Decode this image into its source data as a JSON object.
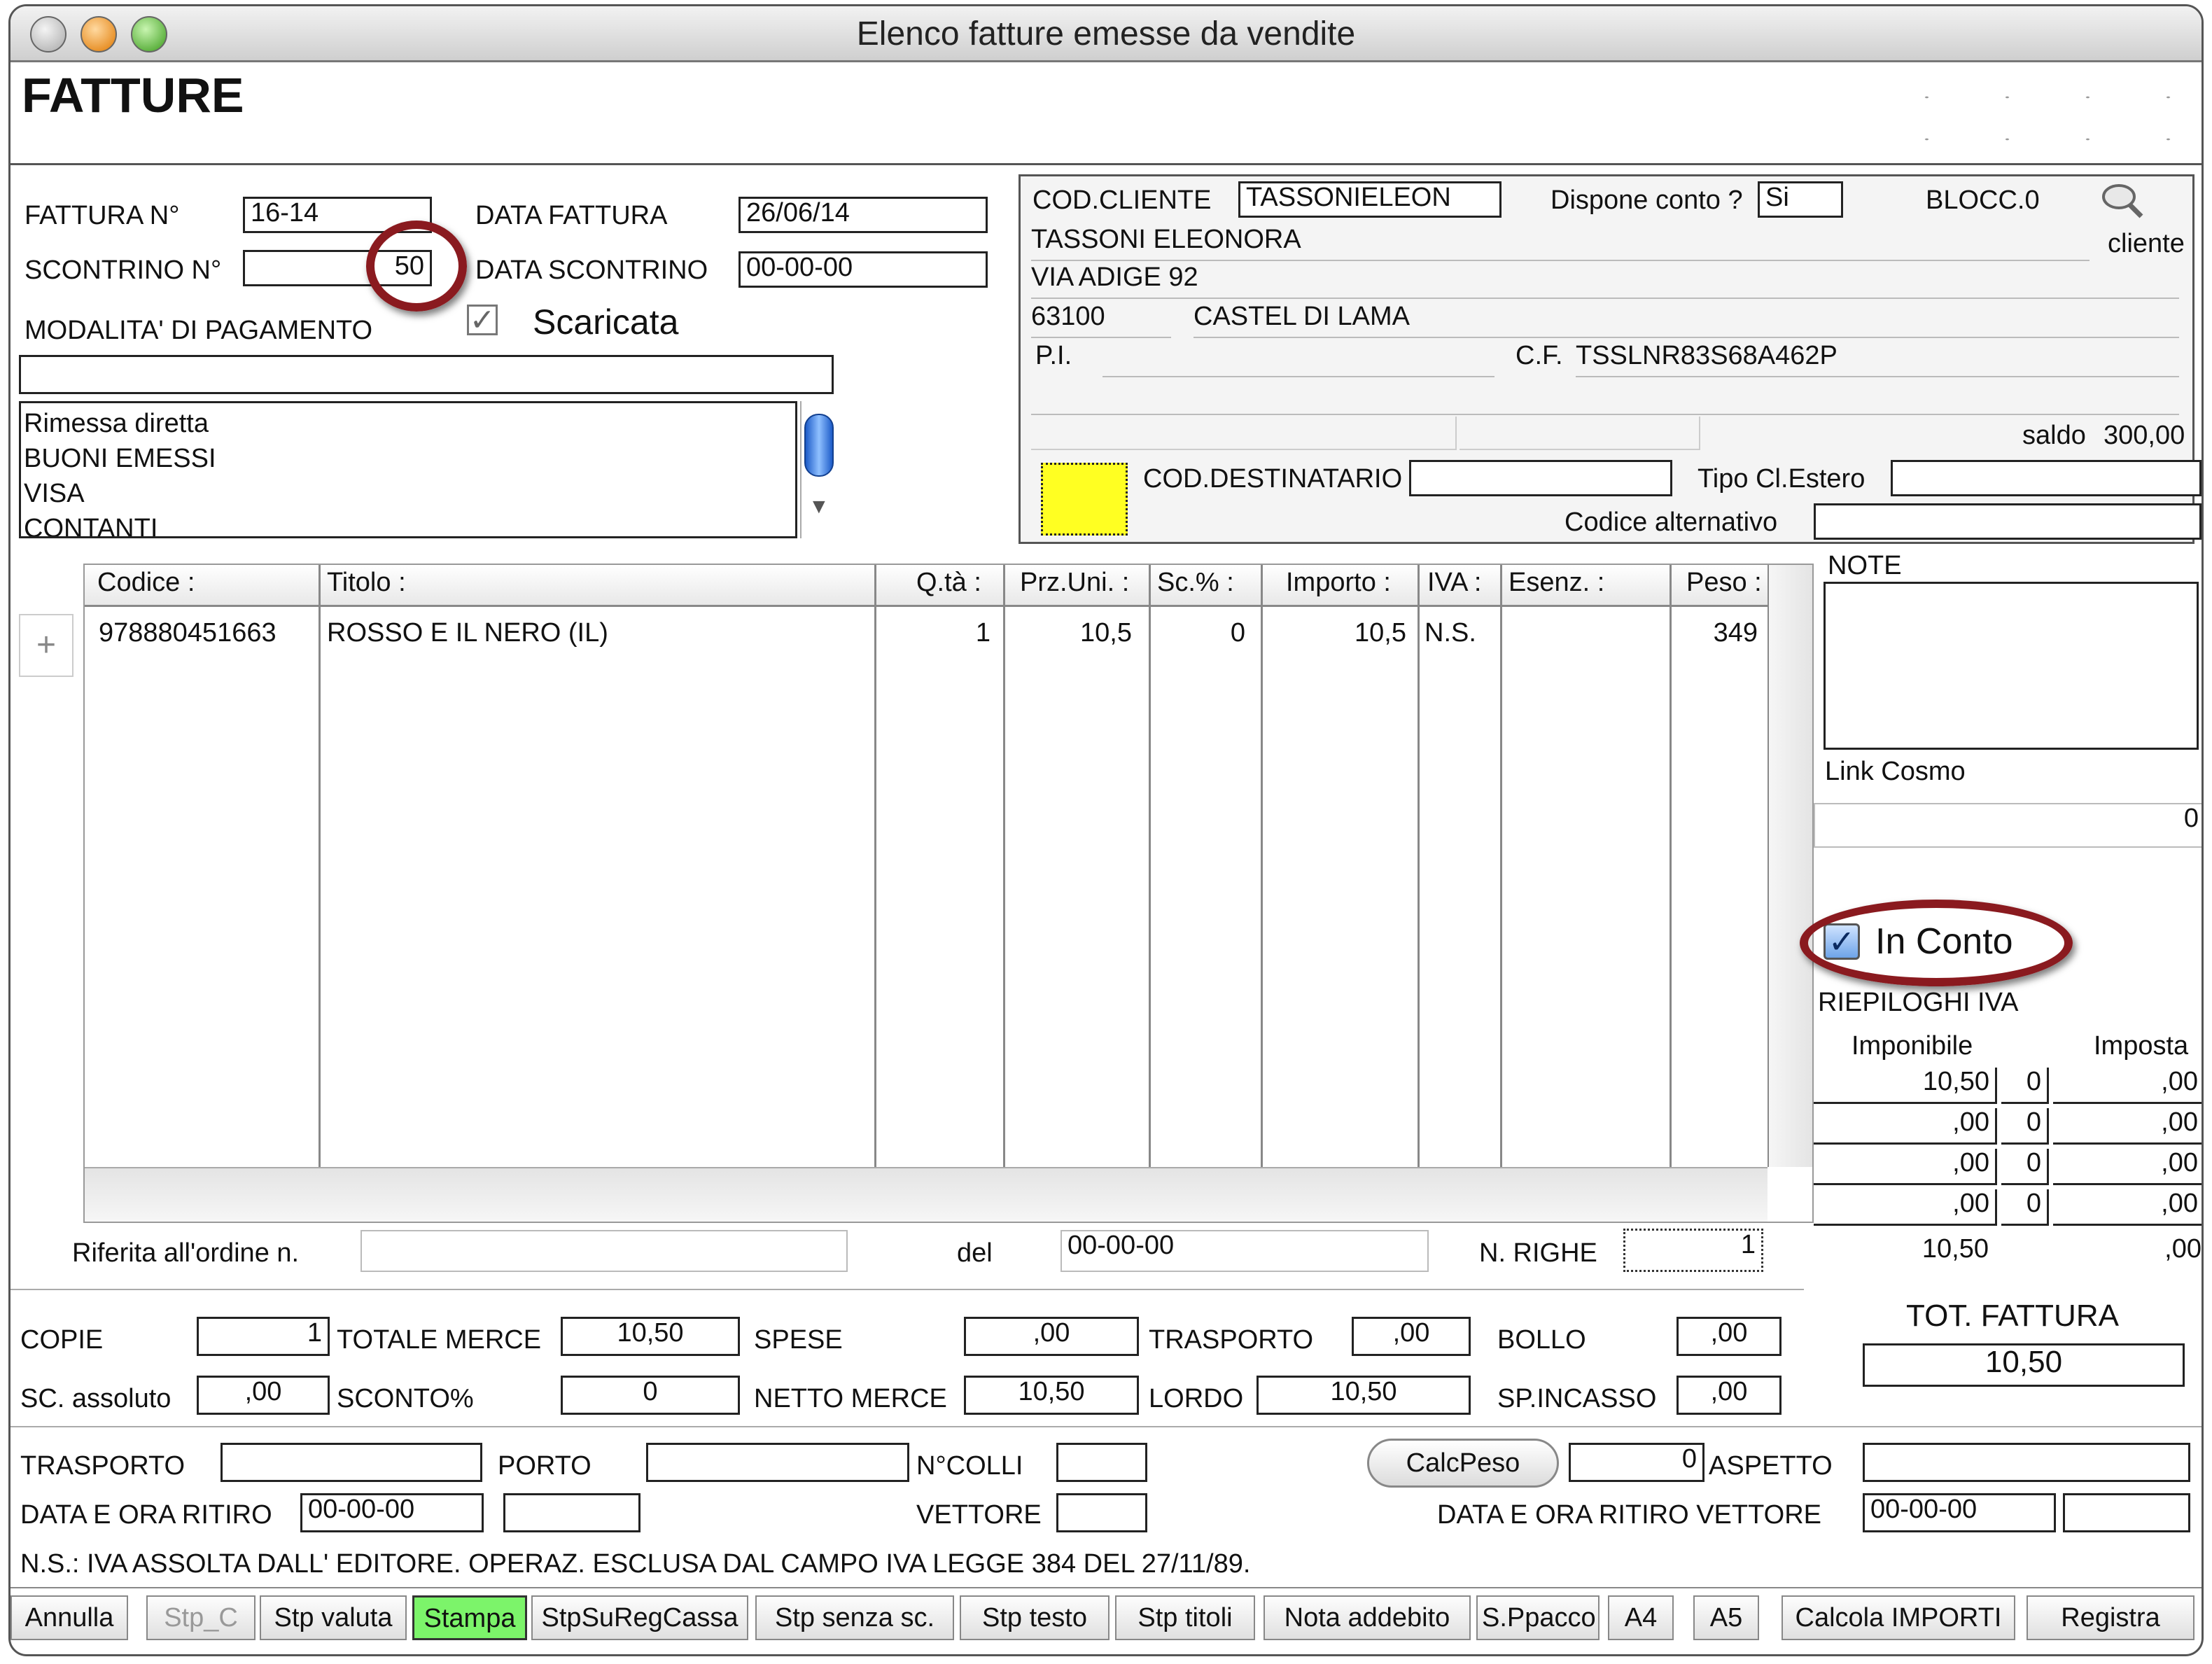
{
  "window": {
    "title": "Elenco fatture emesse da vendite"
  },
  "header": {
    "title": "FATTURE"
  },
  "invoice": {
    "fattura_label": "FATTURA N°",
    "fattura_value": "16-14",
    "data_fattura_label": "DATA FATTURA",
    "data_fattura_value": "26/06/14",
    "scontrino_label": "SCONTRINO N°",
    "scontrino_value": "50",
    "data_scontrino_label": "DATA SCONTRINO",
    "data_scontrino_value": "00-00-00",
    "modalita_label": "MODALITA' DI PAGAMENTO",
    "scaricata_label": "Scaricata",
    "modalita_value": "",
    "payment_options": [
      "Rimessa diretta",
      "BUONI EMESSI",
      "VISA",
      "CONTANTI"
    ]
  },
  "client": {
    "cod_label": "COD.CLIENTE",
    "cod_value": "TASSONIELEON",
    "dispone_label": "Dispone conto ?",
    "dispone_value": "Si",
    "blocc_label": "BLOCC.0",
    "cliente_button": "cliente",
    "name": "TASSONI ELEONORA",
    "address": "VIA ADIGE 92",
    "cap": "63100",
    "city": "CASTEL DI LAMA",
    "pi_label": "P.I.",
    "pi_value": "",
    "cf_label": "C.F.",
    "cf_value": "TSSLNR83S68A462P",
    "saldo_label": "saldo",
    "saldo_value": "300,00",
    "cod_dest_label": "COD.DESTINATARIO",
    "cod_dest_value": "",
    "tipo_estero_label": "Tipo Cl.Estero",
    "tipo_estero_value": "",
    "codice_alt_label": "Codice alternativo",
    "codice_alt_value": ""
  },
  "table": {
    "columns": [
      "Codice :",
      "Titolo :",
      "Q.tà :",
      "Prz.Uni. :",
      "Sc.% :",
      "Importo :",
      "IVA :",
      "Esenz. :",
      "Peso :"
    ],
    "rows": [
      [
        "978880451663",
        "ROSSO E IL NERO (IL)",
        "1",
        "10,5",
        "0",
        "10,5",
        "N.S.",
        "",
        "349"
      ]
    ],
    "add_symbol": "+"
  },
  "notes": {
    "label": "NOTE",
    "value": "",
    "link_label": "Link Cosmo",
    "link_value": "0"
  },
  "inconto": {
    "label": "In Conto",
    "checked": true
  },
  "iva": {
    "title": "RIEPILOGHI IVA",
    "imponibile_label": "Imponibile",
    "imposta_label": "Imposta",
    "rows": [
      [
        "10,50",
        "0",
        ",00"
      ],
      [
        ",00",
        "0",
        ",00"
      ],
      [
        ",00",
        "0",
        ",00"
      ],
      [
        ",00",
        "0",
        ",00"
      ]
    ],
    "total_imponibile": "10,50",
    "total_imposta": ",00"
  },
  "order": {
    "riferita_label": "Riferita all'ordine n.",
    "riferita_value": "",
    "del_label": "del",
    "del_value": "00-00-00",
    "righe_label": "N. RIGHE",
    "righe_value": "1"
  },
  "totals": {
    "copie_label": "COPIE",
    "copie_value": "1",
    "totale_merce_label": "TOTALE MERCE",
    "totale_merce_value": "10,50",
    "spese_label": "SPESE",
    "spese_value": ",00",
    "trasporto_label": "TRASPORTO",
    "trasporto_value": ",00",
    "bollo_label": "BOLLO",
    "bollo_value": ",00",
    "sc_assoluto_label": "SC. assoluto",
    "sc_assoluto_value": ",00",
    "sconto_label": "SCONTO%",
    "sconto_value": "0",
    "netto_label": "NETTO MERCE",
    "netto_value": "10,50",
    "lordo_label": "LORDO",
    "lordo_value": "10,50",
    "incasso_label": "SP.INCASSO",
    "incasso_value": ",00",
    "tot_fattura_label": "TOT. FATTURA",
    "tot_fattura_value": "10,50"
  },
  "shipping": {
    "trasporto_label": "TRASPORTO",
    "trasporto_value": "",
    "porto_label": "PORTO",
    "porto_value": "",
    "colli_label": "N°COLLI",
    "colli_value": "",
    "calcpeso_button": "CalcPeso",
    "peso_value": "0",
    "aspetto_label": "ASPETTO",
    "aspetto_value": "",
    "ritiro_label": "DATA E ORA RITIRO",
    "ritiro_value": "00-00-00",
    "ritiro_ora": "",
    "vettore_label": "VETTORE",
    "vettore_value": "",
    "ritiro_vettore_label": "DATA E ORA RITIRO VETTORE",
    "ritiro_vettore_value": "00-00-00",
    "ritiro_vettore_ora": "",
    "note": "N.S.: IVA ASSOLTA DALL' EDITORE. OPERAZ. ESCLUSA DAL CAMPO IVA LEGGE 384 DEL 27/11/89."
  },
  "buttons": [
    "Annulla",
    "Stp_C",
    "Stp valuta",
    "Stampa",
    "StpSuRegCassa",
    "Stp senza sc.",
    "Stp testo",
    "Stp titoli",
    "Nota addebito",
    "S.Ppacco",
    "A4",
    "A5",
    "Calcola IMPORTI",
    "Registra"
  ],
  "colors": {
    "highlight_yellow": "#ffff22",
    "stampa_green": "#7cf46a",
    "ring": "#8a1a1f"
  }
}
